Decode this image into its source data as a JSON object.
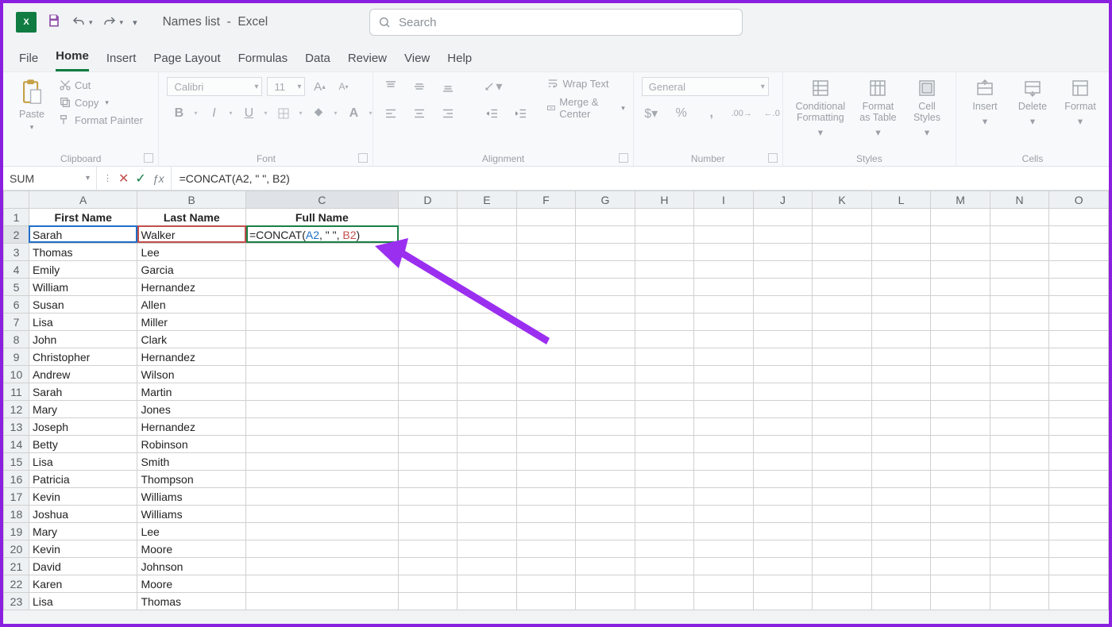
{
  "title": {
    "doc": "Names list",
    "app": "Excel"
  },
  "search": {
    "placeholder": "Search"
  },
  "tabs": [
    "File",
    "Home",
    "Insert",
    "Page Layout",
    "Formulas",
    "Data",
    "Review",
    "View",
    "Help"
  ],
  "active_tab": "Home",
  "ribbon": {
    "clipboard": {
      "paste": "Paste",
      "cut": "Cut",
      "copy": "Copy",
      "painter": "Format Painter",
      "label": "Clipboard"
    },
    "font": {
      "name": "Calibri",
      "size": "11",
      "label": "Font"
    },
    "alignment": {
      "wrap": "Wrap Text",
      "merge": "Merge & Center",
      "label": "Alignment"
    },
    "number": {
      "format": "General",
      "label": "Number"
    },
    "styles": {
      "cond": "Conditional Formatting",
      "table": "Format as Table",
      "cell": "Cell Styles",
      "label": "Styles"
    },
    "cells": {
      "insert": "Insert",
      "delete": "Delete",
      "format": "Format",
      "label": "Cells"
    }
  },
  "fx": {
    "namebox": "SUM",
    "formula": "=CONCAT(A2, \" \", B2)"
  },
  "columns": [
    "A",
    "B",
    "C",
    "D",
    "E",
    "F",
    "G",
    "H",
    "I",
    "J",
    "K",
    "L",
    "M",
    "N",
    "O"
  ],
  "headers": {
    "A": "First Name",
    "B": "Last Name",
    "C": "Full Name"
  },
  "rows": [
    {
      "n": 1
    },
    {
      "n": 2,
      "A": "Sarah",
      "B": "Walker",
      "C": {
        "parts": [
          "=CONCAT(",
          "A2",
          ", \" \", ",
          "B2",
          ")"
        ]
      }
    },
    {
      "n": 3,
      "A": "Thomas",
      "B": "Lee"
    },
    {
      "n": 4,
      "A": "Emily",
      "B": "Garcia"
    },
    {
      "n": 5,
      "A": "William",
      "B": "Hernandez"
    },
    {
      "n": 6,
      "A": "Susan",
      "B": "Allen"
    },
    {
      "n": 7,
      "A": "Lisa",
      "B": "Miller"
    },
    {
      "n": 8,
      "A": "John",
      "B": "Clark"
    },
    {
      "n": 9,
      "A": "Christopher",
      "B": "Hernandez"
    },
    {
      "n": 10,
      "A": "Andrew",
      "B": "Wilson"
    },
    {
      "n": 11,
      "A": "Sarah",
      "B": "Martin"
    },
    {
      "n": 12,
      "A": "Mary",
      "B": "Jones"
    },
    {
      "n": 13,
      "A": "Joseph",
      "B": "Hernandez"
    },
    {
      "n": 14,
      "A": "Betty",
      "B": "Robinson"
    },
    {
      "n": 15,
      "A": "Lisa",
      "B": "Smith"
    },
    {
      "n": 16,
      "A": "Patricia",
      "B": "Thompson"
    },
    {
      "n": 17,
      "A": "Kevin",
      "B": "Williams"
    },
    {
      "n": 18,
      "A": "Joshua",
      "B": "Williams"
    },
    {
      "n": 19,
      "A": "Mary",
      "B": "Lee"
    },
    {
      "n": 20,
      "A": "Kevin",
      "B": "Moore"
    },
    {
      "n": 21,
      "A": "David",
      "B": "Johnson"
    },
    {
      "n": 22,
      "A": "Karen",
      "B": "Moore"
    },
    {
      "n": 23,
      "A": "Lisa",
      "B": "Thomas"
    }
  ],
  "active_cell": "C2",
  "ref_cells": [
    "A2",
    "B2"
  ]
}
